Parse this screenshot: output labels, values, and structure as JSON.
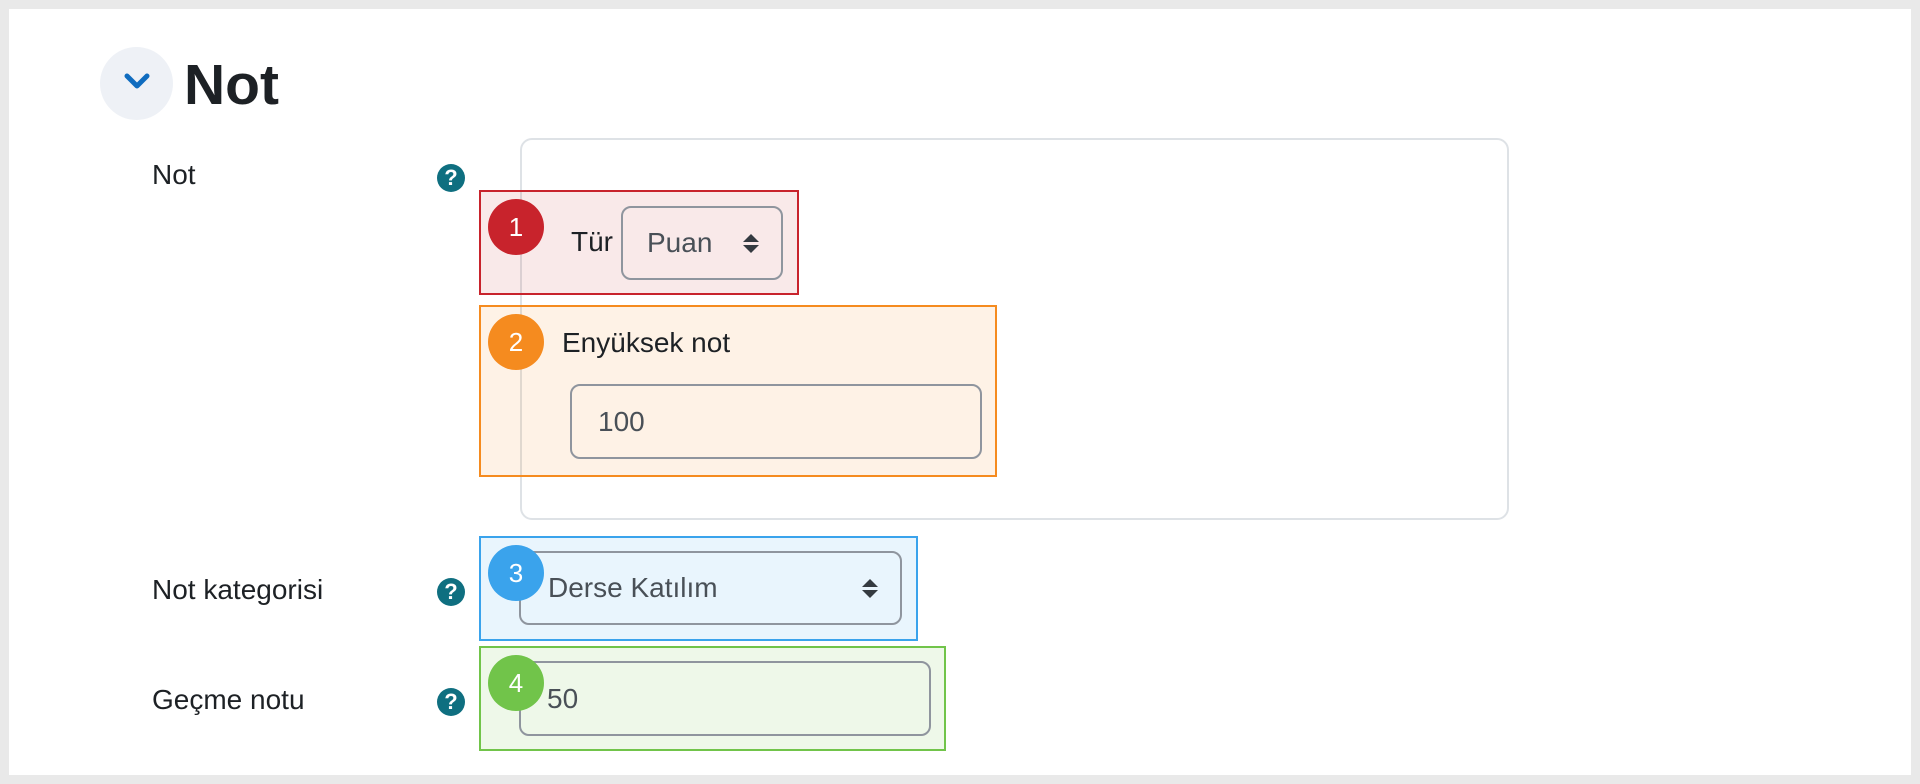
{
  "header": {
    "title": "Not",
    "collapse_icon": "chevron-down-icon"
  },
  "fields": {
    "grade": {
      "label": "Not",
      "help_icon": "question-circle-icon",
      "type_label": "Tür",
      "type_value": "Puan",
      "max_grade_label": "Enyüksek not",
      "max_grade_value": "100"
    },
    "grade_category": {
      "label": "Not kategorisi",
      "help_icon": "question-circle-icon",
      "value": "Derse Katılım"
    },
    "pass_grade": {
      "label": "Geçme notu",
      "help_icon": "question-circle-icon",
      "value": "50"
    }
  },
  "annotations": [
    {
      "number": "1",
      "color": "#c8232c"
    },
    {
      "number": "2",
      "color": "#f58b1f"
    },
    {
      "number": "3",
      "color": "#3aa3ec"
    },
    {
      "number": "4",
      "color": "#71c44a"
    }
  ],
  "colors": {
    "accent": "#0f6cbf",
    "help_icon": "#0f6f80"
  }
}
